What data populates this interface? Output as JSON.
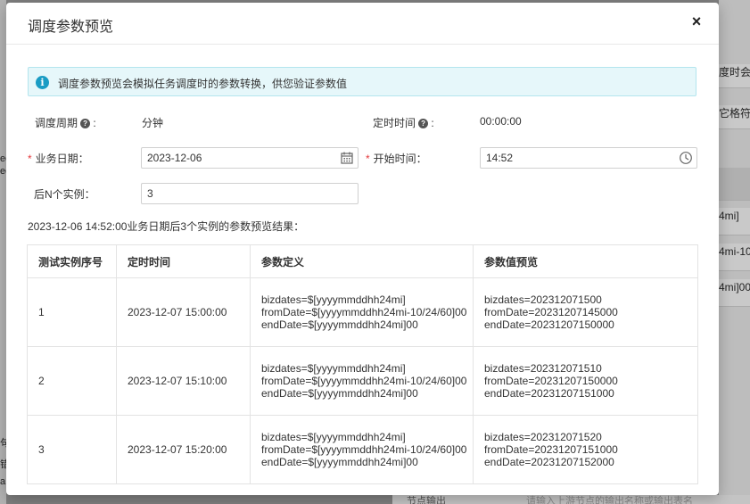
{
  "background": {
    "right_snippets": [
      "度时会",
      "它格符久",
      "4mi]",
      "4mi-10",
      "4mi]00"
    ],
    "left_snippets": [
      "ee",
      "ee",
      "句",
      "错",
      "a"
    ],
    "bottom_select": "节点输出",
    "bottom_placeholder": "请输入上游节点的输出名称或输出表名"
  },
  "modal": {
    "title": "调度参数预览",
    "close_label": "×",
    "alert_text": "调度参数预览会模拟任务调度时的参数转换，供您验证参数值",
    "cycle_label": "调度周期",
    "cycle_value": "分钟",
    "timer_label": "定时时间",
    "timer_value": "00:00:00",
    "biz_date_label": "业务日期：",
    "biz_date_value": "2023-12-06",
    "start_time_label": "开始时间：",
    "start_time_value": "14:52",
    "next_n_label": "后N个实例：",
    "next_n_value": "3",
    "result_title": "2023-12-06 14:52:00业务日期后3个实例的参数预览结果：",
    "table": {
      "headers": [
        "测试实例序号",
        "定时时间",
        "参数定义",
        "参数值预览"
      ],
      "rows": [
        {
          "index": "1",
          "time": "2023-12-07 15:00:00",
          "def": [
            "bizdates=$[yyyymmddhh24mi]",
            "fromDate=$[yyyymmddhh24mi-10/24/60]00",
            "endDate=$[yyyymmddhh24mi]00"
          ],
          "preview": [
            "bizdates=202312071500",
            "fromDate=20231207145000",
            "endDate=20231207150000"
          ]
        },
        {
          "index": "2",
          "time": "2023-12-07 15:10:00",
          "def": [
            "bizdates=$[yyyymmddhh24mi]",
            "fromDate=$[yyyymmddhh24mi-10/24/60]00",
            "endDate=$[yyyymmddhh24mi]00"
          ],
          "preview": [
            "bizdates=202312071510",
            "fromDate=20231207150000",
            "endDate=20231207151000"
          ]
        },
        {
          "index": "3",
          "time": "2023-12-07 15:20:00",
          "def": [
            "bizdates=$[yyyymmddhh24mi]",
            "fromDate=$[yyyymmddhh24mi-10/24/60]00",
            "endDate=$[yyyymmddhh24mi]00"
          ],
          "preview": [
            "bizdates=202312071520",
            "fromDate=20231207151000",
            "endDate=20231207152000"
          ]
        }
      ]
    }
  },
  "colors": {
    "accent": "#1a9cc4",
    "alert_bg": "#e6f7fa",
    "required": "#e4393c"
  }
}
